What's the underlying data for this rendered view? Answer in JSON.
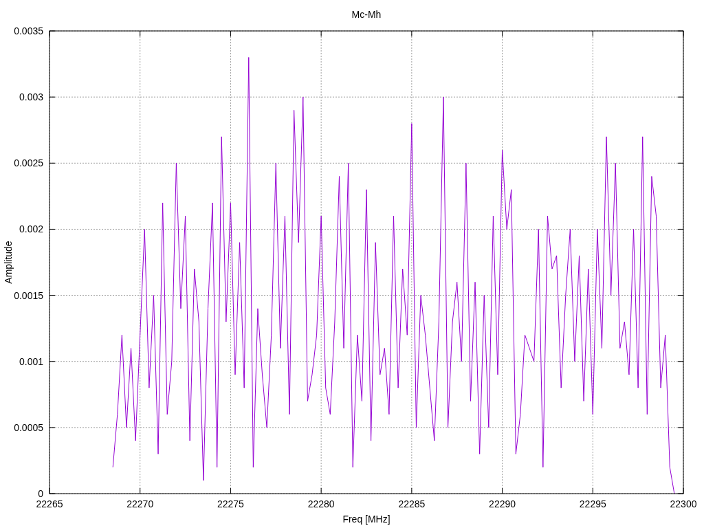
{
  "plot": {
    "chart_data": {
      "type": "line",
      "title": "Mc-Mh",
      "xlabel": "Freq [MHz]",
      "ylabel": "Amplitude",
      "xlim": [
        22265,
        22300
      ],
      "ylim": [
        0,
        0.0035
      ],
      "grid": true,
      "xticks": [
        22265,
        22270,
        22275,
        22280,
        22285,
        22290,
        22295,
        22300
      ],
      "yticks": [
        0,
        0.0005,
        0.001,
        0.0015,
        0.002,
        0.0025,
        0.003,
        0.0035
      ],
      "x": [
        22268.5,
        22268.75,
        22269,
        22269.25,
        22269.5,
        22269.75,
        22270,
        22270.25,
        22270.5,
        22270.75,
        22271,
        22271.25,
        22271.5,
        22271.75,
        22272,
        22272.25,
        22272.5,
        22272.75,
        22273,
        22273.25,
        22273.5,
        22273.75,
        22274,
        22274.25,
        22274.5,
        22274.75,
        22275,
        22275.25,
        22275.5,
        22275.75,
        22276,
        22276.25,
        22276.5,
        22276.75,
        22277,
        22277.25,
        22277.5,
        22277.75,
        22278,
        22278.25,
        22278.5,
        22278.75,
        22279,
        22279.25,
        22279.5,
        22279.75,
        22280,
        22280.25,
        22280.5,
        22280.75,
        22281,
        22281.25,
        22281.5,
        22281.75,
        22282,
        22282.25,
        22282.5,
        22282.75,
        22283,
        22283.25,
        22283.5,
        22283.75,
        22284,
        22284.25,
        22284.5,
        22284.75,
        22285,
        22285.25,
        22285.5,
        22285.75,
        22286,
        22286.25,
        22286.5,
        22286.75,
        22287,
        22287.25,
        22287.5,
        22287.75,
        22288,
        22288.25,
        22288.5,
        22288.75,
        22289,
        22289.25,
        22289.5,
        22289.75,
        22290,
        22290.25,
        22290.5,
        22290.75,
        22291,
        22291.25,
        22291.5,
        22291.75,
        22292,
        22292.25,
        22292.5,
        22292.75,
        22293,
        22293.25,
        22293.5,
        22293.75,
        22294,
        22294.25,
        22294.5,
        22294.75,
        22295,
        22295.25,
        22295.5,
        22295.75,
        22296,
        22296.25,
        22296.5,
        22296.75,
        22297,
        22297.25,
        22297.5,
        22297.75,
        22298,
        22298.25,
        22298.5,
        22298.75,
        22299,
        22299.25,
        22299.5
      ],
      "series": [
        {
          "color": "#9400d3",
          "values": [
            0.0002,
            0.0006,
            0.0012,
            0.0005,
            0.0011,
            0.0004,
            0.0012,
            0.002,
            0.0008,
            0.0015,
            0.0003,
            0.0022,
            0.0006,
            0.001,
            0.0025,
            0.0014,
            0.0021,
            0.0004,
            0.0017,
            0.0013,
            0.0001,
            0.0014,
            0.0022,
            0.0002,
            0.0027,
            0.0013,
            0.0022,
            0.0009,
            0.0019,
            0.0008,
            0.0033,
            0.0002,
            0.0014,
            0.0009,
            0.0005,
            0.0012,
            0.0025,
            0.0011,
            0.0021,
            0.0006,
            0.0029,
            0.0019,
            0.003,
            0.0007,
            0.0009,
            0.0012,
            0.0021,
            0.0008,
            0.0006,
            0.0013,
            0.0024,
            0.0011,
            0.0025,
            0.0002,
            0.0012,
            0.0007,
            0.0023,
            0.0004,
            0.0019,
            0.0009,
            0.0011,
            0.0006,
            0.0021,
            0.0008,
            0.0017,
            0.0012,
            0.0028,
            0.0005,
            0.0015,
            0.0012,
            0.0008,
            0.0004,
            0.0013,
            0.003,
            0.0005,
            0.0013,
            0.0016,
            0.001,
            0.0025,
            0.0007,
            0.0016,
            0.0003,
            0.0015,
            0.0005,
            0.0021,
            0.0009,
            0.0026,
            0.002,
            0.0023,
            0.0003,
            0.0006,
            0.0012,
            0.0011,
            0.001,
            0.002,
            0.0002,
            0.0021,
            0.0017,
            0.0018,
            0.0008,
            0.0015,
            0.002,
            0.001,
            0.0018,
            0.0007,
            0.0017,
            0.0006,
            0.002,
            0.0011,
            0.0027,
            0.0015,
            0.0025,
            0.0011,
            0.0013,
            0.0009,
            0.002,
            0.0008,
            0.0027,
            0.0006,
            0.0024,
            0.0021,
            0.0008,
            0.0012,
            0.0002,
            0
          ]
        }
      ]
    }
  }
}
